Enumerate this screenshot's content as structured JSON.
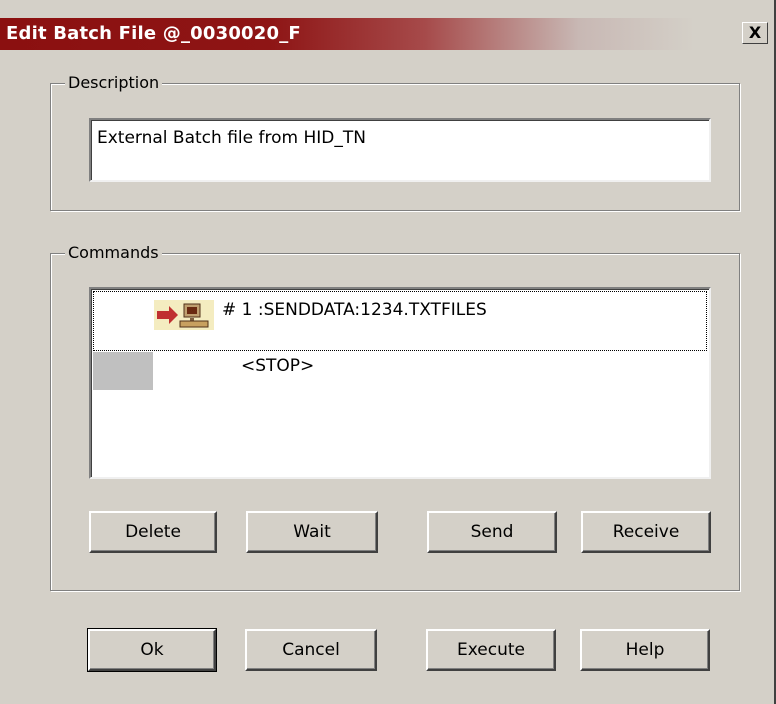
{
  "window": {
    "title": "Edit Batch File @_0030020_F",
    "close_label": "X"
  },
  "description": {
    "group_label": "Description",
    "value": "External Batch file from HID_TN"
  },
  "commands": {
    "group_label": "Commands",
    "items": [
      {
        "icon": "send-arrow-computer-icon",
        "text": "#  1  :SENDDATA:1234.TXTFILES"
      },
      {
        "text": "<STOP>"
      }
    ],
    "buttons": {
      "delete": "Delete",
      "wait": "Wait",
      "send": "Send",
      "receive": "Receive"
    }
  },
  "footer": {
    "ok": "Ok",
    "cancel": "Cancel",
    "execute": "Execute",
    "help": "Help"
  },
  "colors": {
    "title_bar": "#8b1010",
    "dialog_bg": "#d4d0c8"
  }
}
